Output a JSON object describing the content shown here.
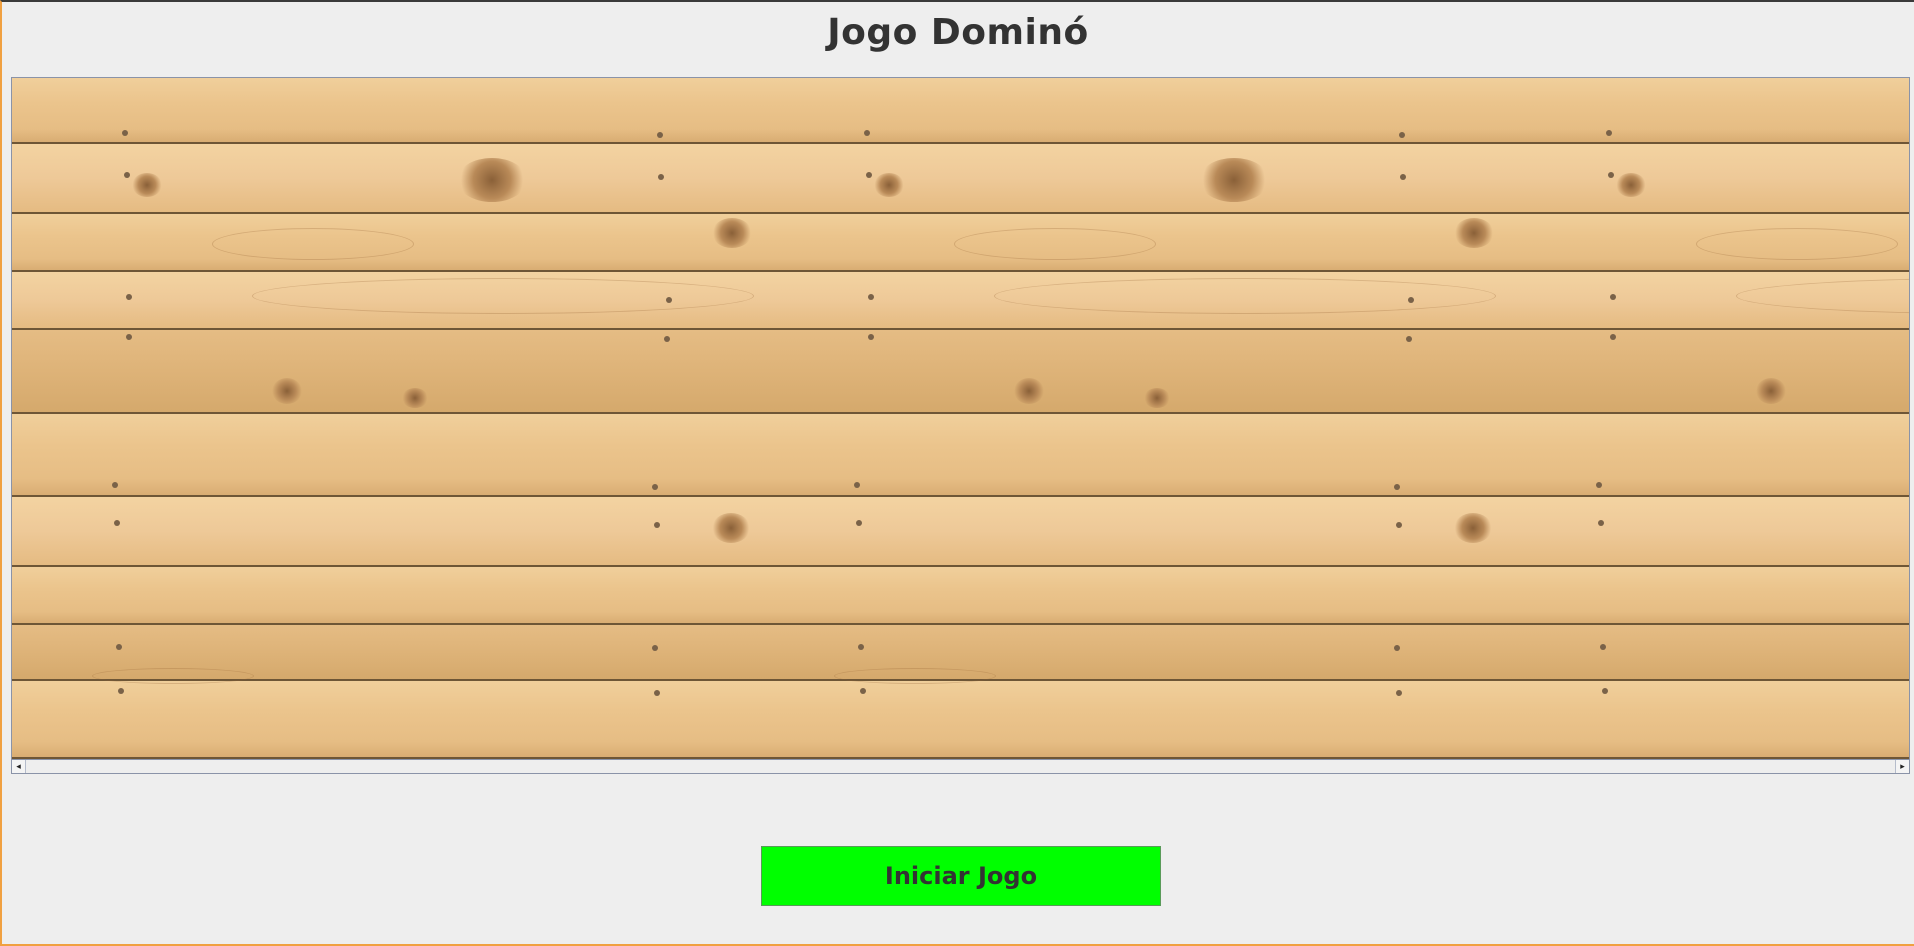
{
  "window": {
    "title": "Jogo Dominó"
  },
  "board": {
    "background": "wood-planks"
  },
  "scrollbar": {
    "left_icon": "arrow-left-icon",
    "right_icon": "arrow-right-icon",
    "left_glyph": "◂",
    "right_glyph": "▸"
  },
  "actions": {
    "start_label": "Iniciar Jogo",
    "start_color": "#00ff00"
  }
}
